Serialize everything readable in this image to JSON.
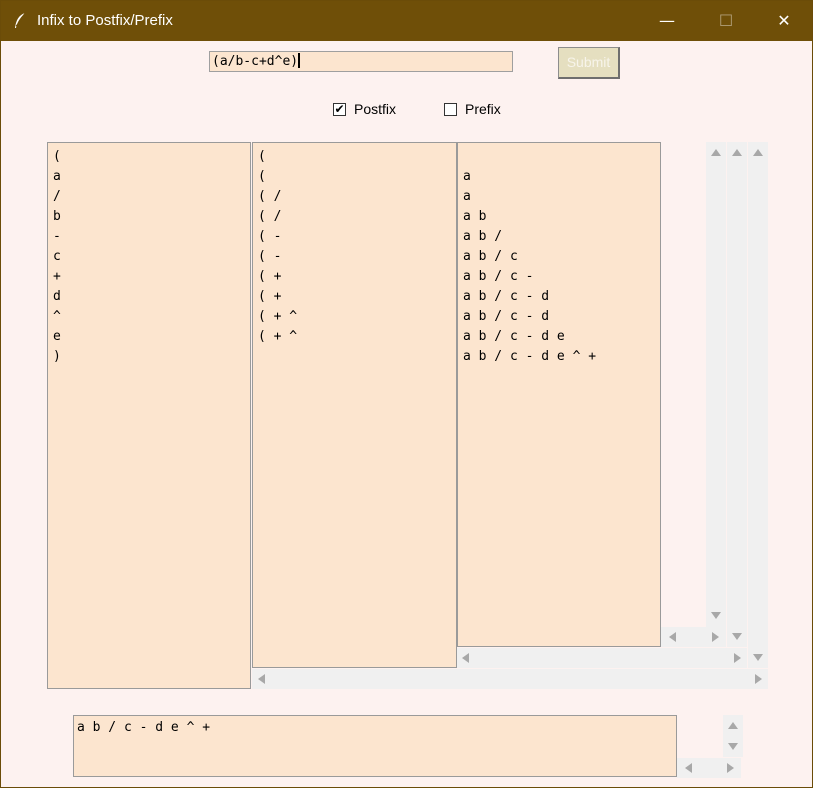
{
  "window": {
    "title": "Infix to Postfix/Prefix",
    "minimize": "—",
    "maximize": "☐",
    "close": "✕"
  },
  "input": {
    "value": "(a/b-c+d^e)"
  },
  "submit_label": "Submit",
  "options": {
    "postfix": {
      "label": "Postfix",
      "checked": true
    },
    "prefix": {
      "label": "Prefix",
      "checked": false
    }
  },
  "columns": {
    "symbols": [
      "(",
      "a",
      "/",
      "b",
      "-",
      "c",
      "+",
      "d",
      "^",
      "e",
      ")"
    ],
    "stack": [
      "(",
      "(",
      "( /",
      "( /",
      "( -",
      "( -",
      "( +",
      "( +",
      "( + ^",
      "( + ^"
    ],
    "output": [
      "",
      "a",
      "a",
      "a b",
      "a b /",
      "a b / c",
      "a b / c -",
      "a b / c - d",
      "a b / c - d",
      "a b / c - d e",
      "a b / c - d e ^ +"
    ]
  },
  "result": "a b / c - d e ^ +",
  "colors": {
    "titlebar": "#6f4f08",
    "window_bg": "#fdf2f0",
    "listbox_bg": "#fce5cf",
    "submit_bg": "#e5dfc0"
  }
}
